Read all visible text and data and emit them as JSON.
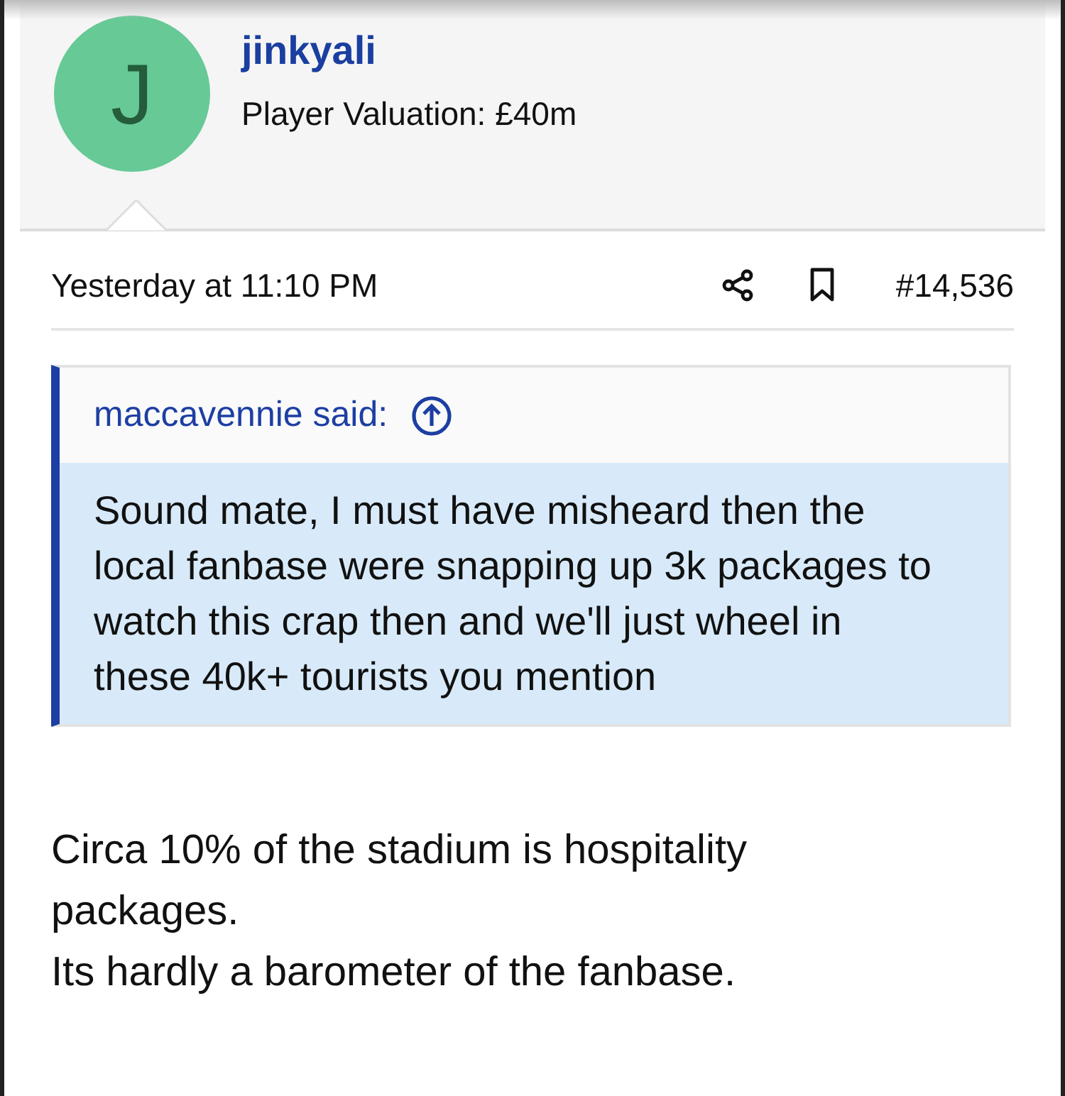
{
  "user": {
    "avatar_letter": "J",
    "name": "jinkyali",
    "valuation": "Player Valuation: £40m"
  },
  "meta": {
    "time": "Yesterday at 11:10 PM",
    "post_number": "#14,536"
  },
  "quote": {
    "author": "maccavennie said:",
    "text": "Sound mate, I must have misheard then the local fanbase were snapping up 3k packages to watch this crap then and we'll just wheel in these 40k+ tourists you mention"
  },
  "body": [
    "Circa 10% of the stadium is hospitality packages.",
    "Its hardly a barometer of the fanbase."
  ]
}
